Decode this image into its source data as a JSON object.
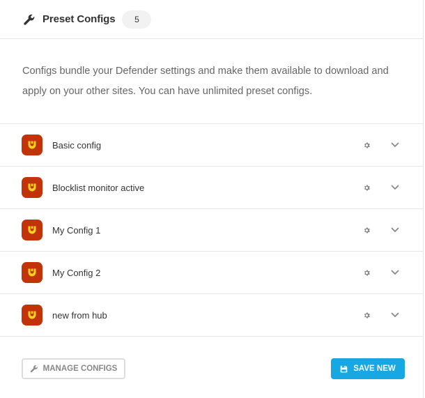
{
  "header": {
    "title": "Preset Configs",
    "count": "5"
  },
  "description": "Configs bundle your Defender settings and make them available to download and apply on your other sites. You can have unlimited preset configs.",
  "configs": [
    {
      "name": "Basic config",
      "icon": "defender-logo-icon"
    },
    {
      "name": "Blocklist monitor active",
      "icon": "defender-logo-icon"
    },
    {
      "name": "My Config 1",
      "icon": "defender-logo-icon"
    },
    {
      "name": "My Config 2",
      "icon": "defender-logo-icon"
    },
    {
      "name": "new from hub",
      "icon": "defender-logo-icon"
    }
  ],
  "footer": {
    "manage_label": "MANAGE CONFIGS",
    "save_label": "SAVE NEW"
  },
  "colors": {
    "accent": "#17a8e3",
    "brand": "#c2330a",
    "brand_mark": "#ffd21f"
  }
}
